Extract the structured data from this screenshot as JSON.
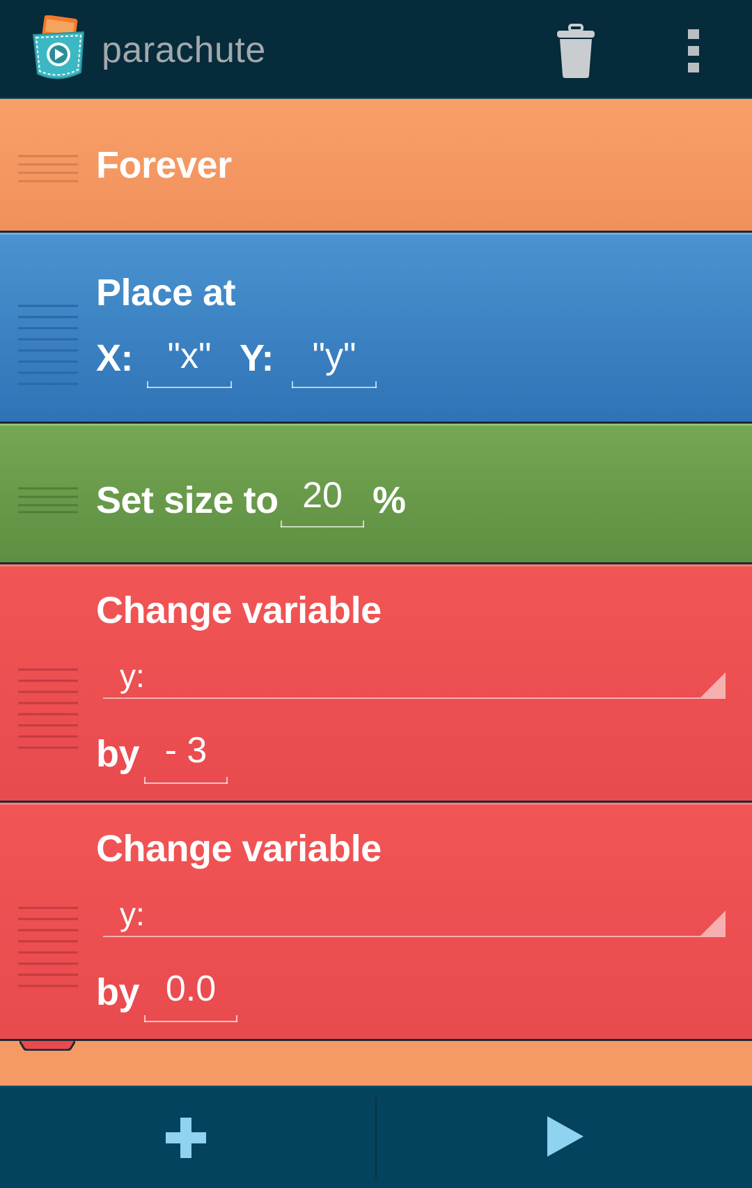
{
  "app": {
    "title": "parachute",
    "icons": {
      "logo": "pocket-play-icon",
      "delete": "trash-icon",
      "overflow": "more-vert-icon"
    }
  },
  "bricks": {
    "forever": {
      "title": "Forever",
      "color": "#f59a64"
    },
    "place_at": {
      "title": "Place at",
      "x_label": "X:",
      "x_value": "\"x\"",
      "y_label": "Y:",
      "y_value": "\"y\"",
      "color": "#3a82c4"
    },
    "set_size": {
      "title": "Set size to",
      "value": "20",
      "unit": "%",
      "color": "#68994a"
    },
    "change_var_1": {
      "title": "Change variable",
      "variable": "y:",
      "by_label": "by",
      "by_value": "- 3",
      "color": "#ef5050"
    },
    "change_var_2": {
      "title": "Change variable",
      "variable": "y:",
      "by_label": "by",
      "by_value": "0.0",
      "color": "#ef5050"
    }
  },
  "bottom_bar": {
    "icons": {
      "add": "plus-icon",
      "play": "play-icon"
    }
  },
  "colors": {
    "action_bar": "#062b3b",
    "bottom_bar": "#03435e"
  }
}
